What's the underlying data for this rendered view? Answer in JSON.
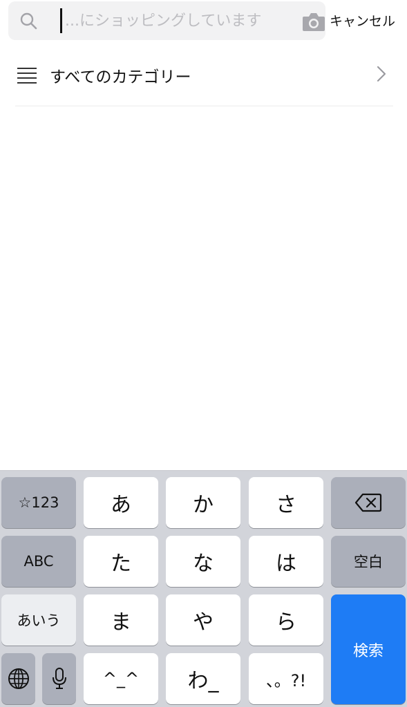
{
  "search": {
    "placeholder": "...にショッピングしています",
    "cancel_label": "キャンセル"
  },
  "category": {
    "label": "すべてのカテゴリー"
  },
  "keyboard": {
    "keys": {
      "num": "☆123",
      "abc": "ABC",
      "aiu": "あいう",
      "a": "あ",
      "ka": "か",
      "sa": "さ",
      "ta": "た",
      "na": "な",
      "ha": "は",
      "ma": "ま",
      "ya": "や",
      "ra": "ら",
      "face": "^_^",
      "wa": "わ_",
      "punct": "、。?!",
      "space": "空白",
      "search": "検索"
    },
    "search_key_color": "#1e7cf5"
  },
  "icons": [
    "search-icon",
    "camera-icon",
    "list-icon",
    "chevron-right-icon",
    "backspace-icon",
    "globe-icon",
    "microphone-icon"
  ]
}
